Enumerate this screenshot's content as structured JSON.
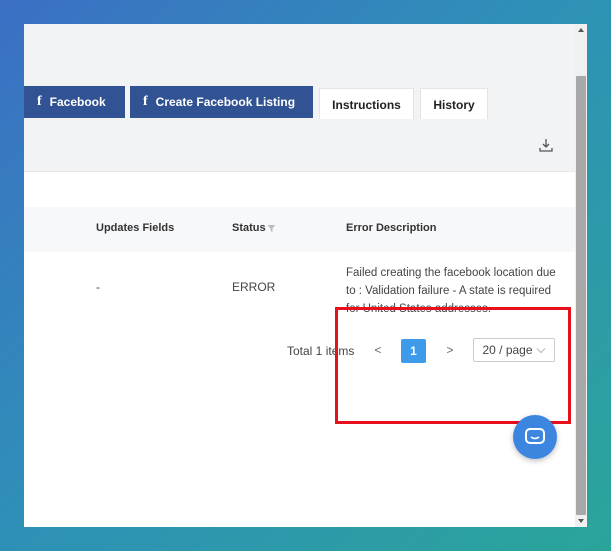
{
  "tabs": {
    "facebook": "Facebook",
    "create_facebook_listing": "Create Facebook Listing",
    "instructions": "Instructions",
    "history": "History",
    "fb_glyph": "f"
  },
  "toolbar": {
    "download_icon": "download-icon"
  },
  "table": {
    "columns": {
      "updates_fields": "Updates Fields",
      "status": "Status",
      "error_description": "Error Description"
    },
    "rows": [
      {
        "updates_fields": "-",
        "status": "ERROR",
        "error_description_lines": [
          "Failed creating the facebook location due",
          "to : Validation failure - A state is required",
          "for United States addresses."
        ]
      }
    ]
  },
  "pagination": {
    "total_text": "Total 1 items",
    "prev": "<",
    "current_page": "1",
    "next": ">",
    "page_size": "20 / page"
  },
  "colors": {
    "tab_blue": "#325393",
    "highlight_red": "#e8111b",
    "page_active": "#3d9be9",
    "chat_button": "#3d86e0"
  }
}
